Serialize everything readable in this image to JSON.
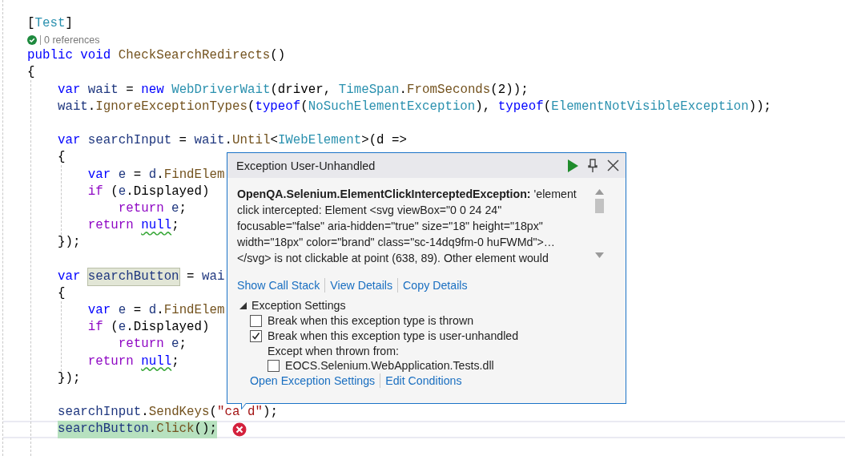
{
  "editor": {
    "lines": [
      {
        "kind": "code",
        "current": false,
        "error": false,
        "tokens": [
          {
            "t": "[",
            "kind": "plain"
          },
          {
            "t": "Test",
            "kind": "type"
          },
          {
            "t": "]",
            "kind": "plain"
          }
        ]
      },
      {
        "kind": "codelens",
        "passed": true,
        "text": "0 references"
      },
      {
        "kind": "code",
        "current": false,
        "error": false,
        "tokens": [
          {
            "t": "public void",
            "kind": "kw"
          },
          {
            "t": " CheckSearchRedirects",
            "kind": "method"
          },
          {
            "t": "()",
            "kind": "plain"
          }
        ]
      },
      {
        "kind": "code",
        "current": false,
        "error": false,
        "tokens": [
          {
            "t": "{",
            "kind": "plain"
          }
        ]
      },
      {
        "kind": "code",
        "current": false,
        "error": false,
        "tokens": [
          {
            "t": "    var",
            "kind": "kw"
          },
          {
            "t": " wait",
            "kind": "local"
          },
          {
            "t": " = ",
            "kind": "plain"
          },
          {
            "t": "new",
            "kind": "kw"
          },
          {
            "t": " WebDriverWait",
            "kind": "type"
          },
          {
            "t": "(driver, ",
            "kind": "plain"
          },
          {
            "t": "TimeSpan",
            "kind": "type"
          },
          {
            "t": ".",
            "kind": "plain"
          },
          {
            "t": "FromSeconds",
            "kind": "method"
          },
          {
            "t": "(2));",
            "kind": "plain"
          }
        ]
      },
      {
        "kind": "code",
        "current": false,
        "error": false,
        "tokens": [
          {
            "t": "    wait",
            "kind": "local"
          },
          {
            "t": ".",
            "kind": "plain"
          },
          {
            "t": "IgnoreExceptionTypes",
            "kind": "method"
          },
          {
            "t": "(",
            "kind": "plain"
          },
          {
            "t": "typeof",
            "kind": "kw"
          },
          {
            "t": "(",
            "kind": "plain"
          },
          {
            "t": "NoSuchElementException",
            "kind": "type"
          },
          {
            "t": "), ",
            "kind": "plain"
          },
          {
            "t": "typeof",
            "kind": "kw"
          },
          {
            "t": "(",
            "kind": "plain"
          },
          {
            "t": "ElementNotVisibleException",
            "kind": "type"
          },
          {
            "t": "));",
            "kind": "plain"
          }
        ]
      },
      {
        "kind": "blank"
      },
      {
        "kind": "code",
        "current": false,
        "error": false,
        "tokens": [
          {
            "t": "    var",
            "kind": "kw"
          },
          {
            "t": " searchInput",
            "kind": "local"
          },
          {
            "t": " = ",
            "kind": "plain"
          },
          {
            "t": "wait",
            "kind": "local"
          },
          {
            "t": ".",
            "kind": "plain"
          },
          {
            "t": "Until",
            "kind": "method"
          },
          {
            "t": "<",
            "kind": "plain"
          },
          {
            "t": "IWebElement",
            "kind": "type"
          },
          {
            "t": ">(d =>",
            "kind": "plain"
          }
        ]
      },
      {
        "kind": "code",
        "current": false,
        "error": false,
        "tokens": [
          {
            "t": "    {",
            "kind": "plain"
          }
        ]
      },
      {
        "kind": "code",
        "current": false,
        "error": false,
        "tokens": [
          {
            "t": "        var",
            "kind": "kw"
          },
          {
            "t": " e",
            "kind": "local"
          },
          {
            "t": " = ",
            "kind": "plain"
          },
          {
            "t": "d",
            "kind": "local"
          },
          {
            "t": ".",
            "kind": "plain"
          },
          {
            "t": "FindElem",
            "kind": "method"
          }
        ]
      },
      {
        "kind": "code",
        "current": false,
        "error": false,
        "tokens": [
          {
            "t": "        if",
            "kind": "ctl"
          },
          {
            "t": " (",
            "kind": "plain"
          },
          {
            "t": "e",
            "kind": "local"
          },
          {
            "t": ".Displayed)",
            "kind": "plain"
          }
        ]
      },
      {
        "kind": "code",
        "current": false,
        "error": false,
        "tokens": [
          {
            "t": "            return",
            "kind": "ctl"
          },
          {
            "t": " e",
            "kind": "local"
          },
          {
            "t": ";",
            "kind": "plain"
          }
        ]
      },
      {
        "kind": "code",
        "current": false,
        "error": false,
        "tokens": [
          {
            "t": "        return ",
            "kind": "ctl"
          },
          {
            "t": "null",
            "kind": "kw-squiggle"
          },
          {
            "t": ";",
            "kind": "plain"
          }
        ]
      },
      {
        "kind": "code",
        "current": false,
        "error": false,
        "tokens": [
          {
            "t": "    });",
            "kind": "plain"
          }
        ]
      },
      {
        "kind": "blank"
      },
      {
        "kind": "code",
        "current": false,
        "error": false,
        "tokens": [
          {
            "t": "    var ",
            "kind": "kw"
          },
          {
            "t": "searchButton",
            "kind": "local-highlight"
          },
          {
            "t": " = ",
            "kind": "plain"
          },
          {
            "t": "wai",
            "kind": "local"
          }
        ]
      },
      {
        "kind": "code",
        "current": false,
        "error": false,
        "tokens": [
          {
            "t": "    {",
            "kind": "plain"
          }
        ]
      },
      {
        "kind": "code",
        "current": false,
        "error": false,
        "tokens": [
          {
            "t": "        var",
            "kind": "kw"
          },
          {
            "t": " e",
            "kind": "local"
          },
          {
            "t": " = ",
            "kind": "plain"
          },
          {
            "t": "d",
            "kind": "local"
          },
          {
            "t": ".",
            "kind": "plain"
          },
          {
            "t": "FindElem",
            "kind": "method"
          }
        ]
      },
      {
        "kind": "code",
        "current": false,
        "error": false,
        "tokens": [
          {
            "t": "        if",
            "kind": "ctl"
          },
          {
            "t": " (",
            "kind": "plain"
          },
          {
            "t": "e",
            "kind": "local"
          },
          {
            "t": ".Displayed)",
            "kind": "plain"
          }
        ]
      },
      {
        "kind": "code",
        "current": false,
        "error": false,
        "tokens": [
          {
            "t": "            return",
            "kind": "ctl"
          },
          {
            "t": " e",
            "kind": "local"
          },
          {
            "t": ";",
            "kind": "plain"
          }
        ]
      },
      {
        "kind": "code",
        "current": false,
        "error": false,
        "tokens": [
          {
            "t": "        return ",
            "kind": "ctl"
          },
          {
            "t": "null",
            "kind": "kw-squiggle"
          },
          {
            "t": ";",
            "kind": "plain"
          }
        ]
      },
      {
        "kind": "code",
        "current": false,
        "error": false,
        "tokens": [
          {
            "t": "    });",
            "kind": "plain"
          }
        ]
      },
      {
        "kind": "blank"
      },
      {
        "kind": "code",
        "current": false,
        "error": false,
        "tokens": [
          {
            "t": "    searchInput",
            "kind": "local"
          },
          {
            "t": ".",
            "kind": "plain"
          },
          {
            "t": "SendKeys",
            "kind": "method"
          },
          {
            "t": "(",
            "kind": "plain"
          },
          {
            "t": "\"ca",
            "kind": "str"
          },
          {
            "t": "d\"",
            "kind": "str-after-gap"
          },
          {
            "t": ");",
            "kind": "plain"
          }
        ]
      },
      {
        "kind": "code",
        "current": true,
        "error": true,
        "tokens": [
          {
            "t": "searchButton",
            "kind": "local"
          },
          {
            "t": ".",
            "kind": "plain"
          },
          {
            "t": "Click",
            "kind": "method"
          },
          {
            "t": "();",
            "kind": "plain"
          }
        ]
      }
    ]
  },
  "exception_popup": {
    "title": "Exception User-Unhandled",
    "message": "**OpenQA.Selenium.ElementClickInterceptedException:** 'element click intercepted: Element <svg viewBox=\"0 0 24 24\" focusable=\"false\" aria-hidden=\"true\" size=\"18\" height=\"18px\" width=\"18px\" color=\"brand\" class=\"sc-14dq9fm-0 huFWMd\">…</svg> is not clickable at point (638, 89). Other element would",
    "links": [
      "Show Call Stack",
      "View Details",
      "Copy Details"
    ],
    "settings": {
      "heading": "Exception Settings",
      "expanded": true,
      "options": [
        {
          "label": "Break when this exception type is thrown",
          "checked": false
        },
        {
          "label": "Break when this exception type is user-unhandled",
          "checked": true
        }
      ],
      "except_label": "Except when thrown from:",
      "modules": [
        {
          "label": "EOCS.Selenium.WebApplication.Tests.dll",
          "checked": false
        }
      ]
    },
    "footer_links": [
      "Open Exception Settings",
      "Edit Conditions"
    ]
  }
}
